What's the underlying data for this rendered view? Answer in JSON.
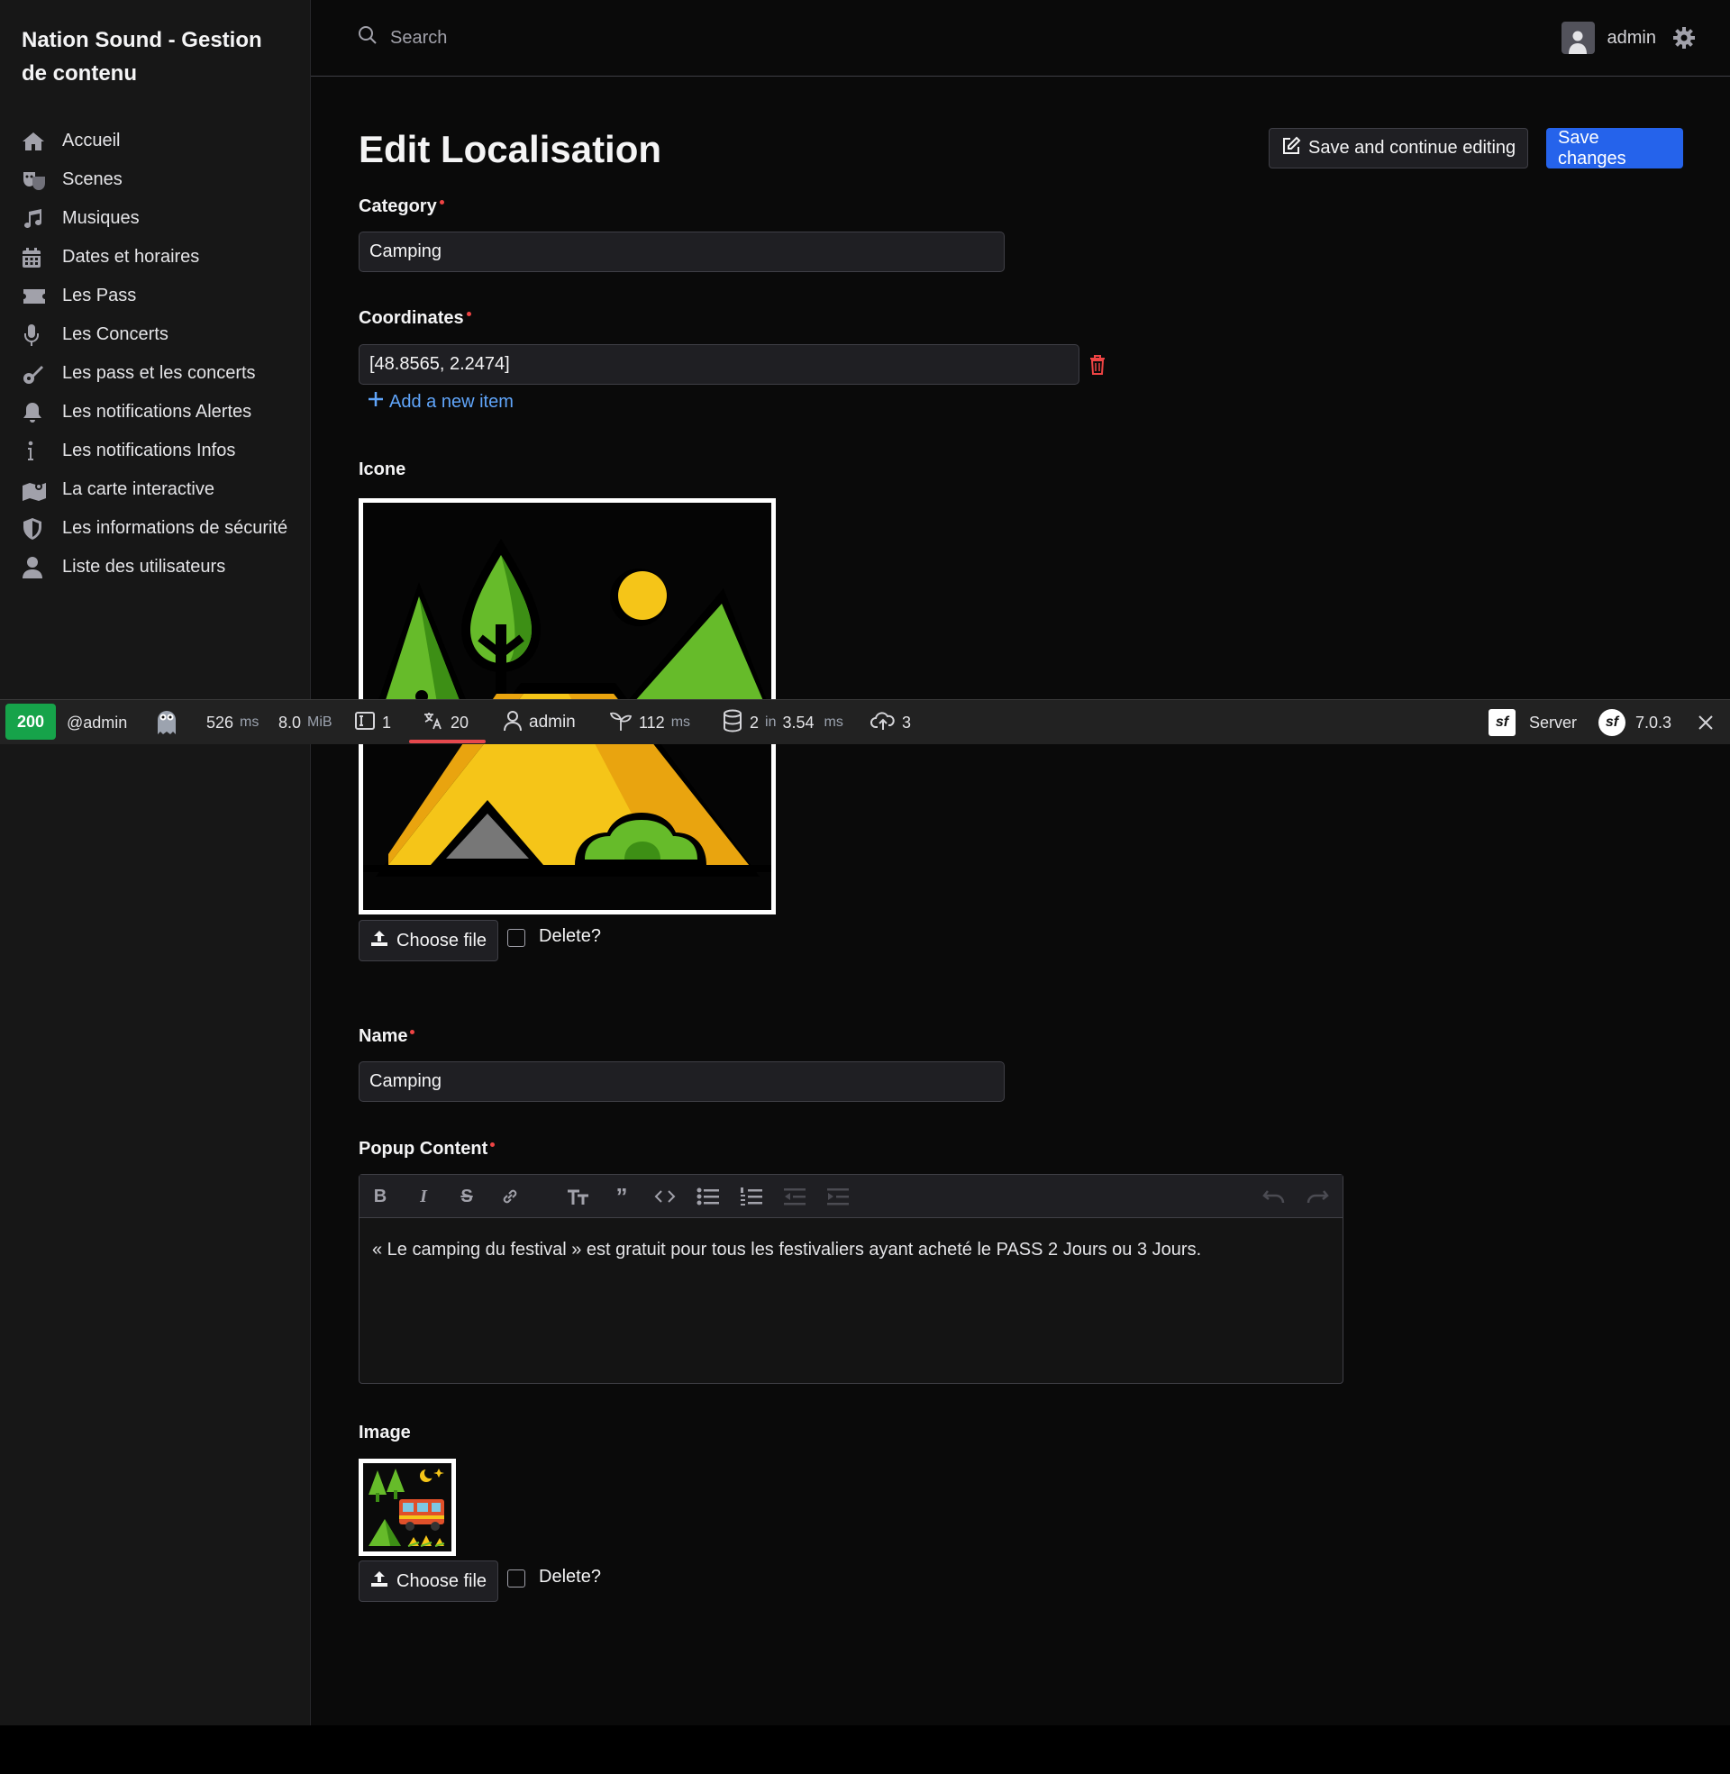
{
  "brand": "Nation Sound - Gestion de contenu",
  "menu": [
    {
      "label": "Accueil",
      "icon": "home-icon"
    },
    {
      "label": "Scenes",
      "icon": "theater-masks-icon"
    },
    {
      "label": "Musiques",
      "icon": "music-icon"
    },
    {
      "label": "Dates et horaires",
      "icon": "calendar-icon"
    },
    {
      "label": "Les Pass",
      "icon": "ticket-icon"
    },
    {
      "label": "Les Concerts",
      "icon": "microphone-icon"
    },
    {
      "label": "Les pass et les concerts",
      "icon": "guitar-icon"
    },
    {
      "label": "Les notifications Alertes",
      "icon": "bell-icon"
    },
    {
      "label": "Les notifications Infos",
      "icon": "info-icon"
    },
    {
      "label": "La carte interactive",
      "icon": "map-icon"
    },
    {
      "label": "Les informations de sécurité",
      "icon": "shield-icon"
    },
    {
      "label": "Liste des utilisateurs",
      "icon": "user-icon"
    }
  ],
  "topbar": {
    "search_placeholder": "Search",
    "username": "admin"
  },
  "page": {
    "title": "Edit Localisation",
    "save_continue_label": "Save and continue editing",
    "save_label": "Save changes"
  },
  "form": {
    "category_label": "Category",
    "category_value": "Camping",
    "coordinates_label": "Coordinates",
    "coordinates_value": "[48.8565, 2.2474]",
    "add_item_label": "Add a new item",
    "icone_label": "Icone",
    "choose_file_label": "Choose file",
    "delete_label": "Delete?",
    "name_label": "Name",
    "name_value": "Camping",
    "popup_label": "Popup Content",
    "popup_value": "« Le camping du festival » est gratuit pour tous les festivaliers ayant acheté le PASS 2 Jours ou 3 Jours.",
    "image_label": "Image"
  },
  "profiler": {
    "status": "200",
    "user": "@admin",
    "time": "526",
    "time_unit": "ms",
    "memory": "8.0",
    "memory_unit": "MiB",
    "forms": "1",
    "translations": "20",
    "security_user": "admin",
    "twig_time": "112",
    "twig_unit": "ms",
    "db_queries": "2",
    "db_in": "in",
    "db_time": "3.54",
    "db_unit": "ms",
    "http": "3",
    "server_label": "Server",
    "version": "7.0.3"
  },
  "colors": {
    "accent": "#2563eb",
    "status_ok": "#16a34a",
    "required": "#ef4444",
    "link": "#60a5fa"
  }
}
